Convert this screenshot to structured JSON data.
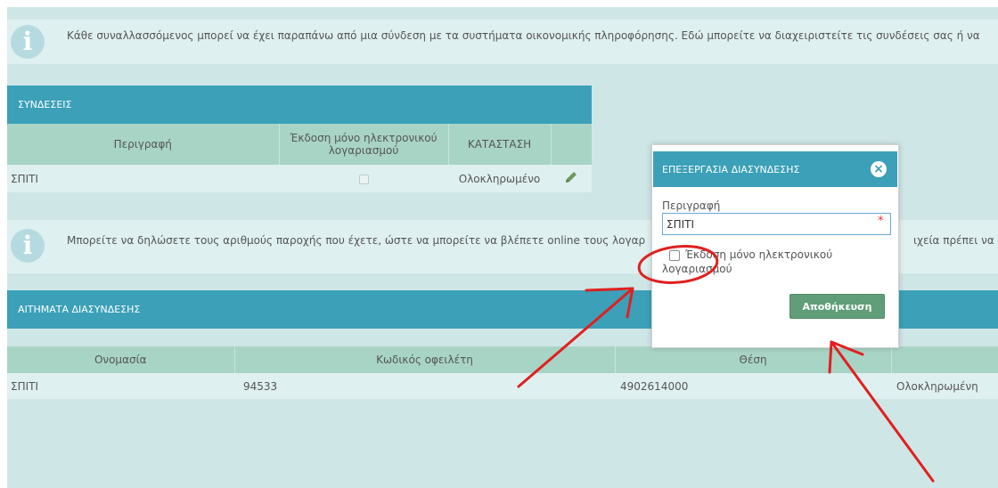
{
  "info_top": {
    "icon": "info-icon",
    "text": "Κάθε συναλλασσόμενος μπορεί να έχει παραπάνω από μια σύνδεση με τα συστήματα οικονομικής πληροφόρησης. Εδώ μπορείτε να διαχειριστείτε τις συνδέσεις σας ή να"
  },
  "connections": {
    "title": "ΣΥΝΔΕΣΕΙΣ",
    "headers": [
      "Περιγραφή",
      "Έκδοση μόνο ηλεκτρονικού λογαριασμού",
      "ΚΑΤΑΣΤΑΣΗ",
      ""
    ],
    "row": {
      "description": "ΣΠΙΤΙ",
      "electronic_only": false,
      "status": "Ολοκληρωμένο",
      "edit_icon": "pencil-icon"
    }
  },
  "info_middle": {
    "icon": "info-icon",
    "text_left": "Μπορείτε να δηλώσετε τους αριθμούς παροχής που έχετε, ώστε να  μπορείτε να βλέπετε online τους λογαρ",
    "text_right": "ιχεία πρέπει να σ"
  },
  "requests": {
    "title": "ΑΙΤΗΜΑΤΑ ΔΙΑΣΥΝΔΕΣΗΣ",
    "headers": [
      "Ονομασία",
      "Κωδικός οφειλέτη",
      "Θέση",
      ""
    ],
    "row": [
      "ΣΠΙΤΙ",
      "94533",
      "4902614000",
      "Ολοκληρωμένη"
    ]
  },
  "modal": {
    "title": "ΕΠΕΞΕΡΓΑΣΙΑ ΔΙΑΣΥΝΔΕΣΗΣ",
    "close_icon": "close-icon",
    "field_label": "Περιγραφή",
    "field_value": "ΣΠΙΤΙ",
    "required_mark": "*",
    "checkbox_label": "Έκδοση μόνο ηλεκτρονικού λογαριασμού",
    "checkbox_checked": false,
    "save_label": "Αποθήκευση"
  },
  "colors": {
    "header_teal": "#3ba0b8",
    "table_header_green": "#a8d4c6",
    "save_green": "#5f9e78",
    "annotation_red": "#e02020"
  }
}
